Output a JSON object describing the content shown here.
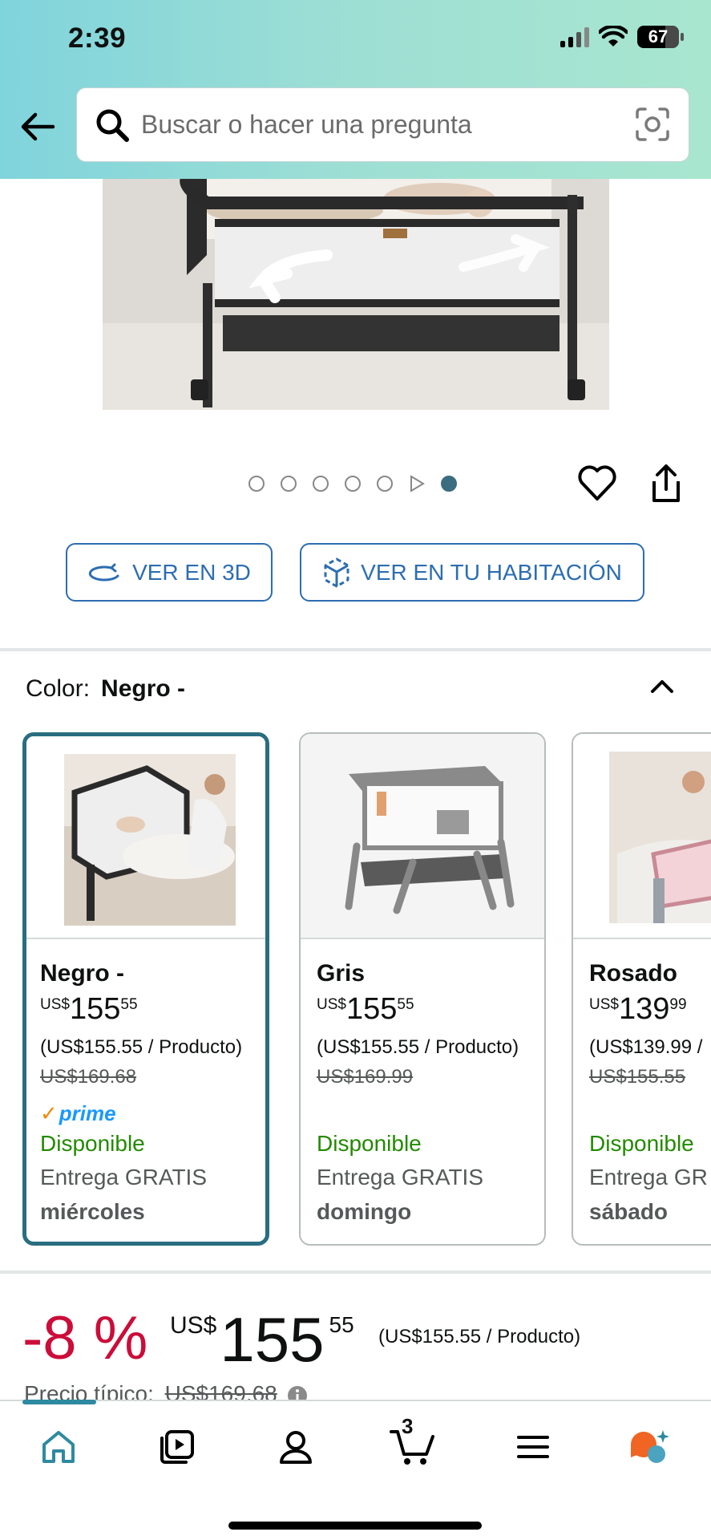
{
  "status_bar": {
    "time": "2:39",
    "battery": "67"
  },
  "search": {
    "placeholder": "Buscar o hacer una pregunta"
  },
  "gallery": {
    "dot_count": 7,
    "active_index": 6
  },
  "actions": {
    "view_3d": "VER EN 3D",
    "view_room": "VER EN TU HABITACIÓN"
  },
  "color_section": {
    "label": "Color:",
    "selected": "Negro -"
  },
  "variants": [
    {
      "name": "Negro -",
      "currency": "US$",
      "whole": "155",
      "fraction": "55",
      "unit_price": "(US$155.55 / Producto)",
      "list_price": "US$169.68",
      "prime": "prime",
      "availability": "Disponible",
      "delivery": "Entrega GRATIS",
      "delivery_day": "miércoles"
    },
    {
      "name": "Gris",
      "currency": "US$",
      "whole": "155",
      "fraction": "55",
      "unit_price": "(US$155.55 / Producto)",
      "list_price": "US$169.99",
      "availability": "Disponible",
      "delivery": "Entrega GRATIS",
      "delivery_day": "domingo"
    },
    {
      "name": "Rosado",
      "currency": "US$",
      "whole": "139",
      "fraction": "99",
      "unit_price": "(US$139.99 /",
      "list_price": "US$155.55",
      "availability": "Disponible",
      "delivery": "Entrega GR",
      "delivery_day": "sábado"
    }
  ],
  "price_block": {
    "discount": "-8 %",
    "currency": "US$",
    "whole": "155",
    "fraction": "55",
    "unit_price": "(US$155.55 / Producto)",
    "typical_label": "Precio típico:",
    "typical_price": "US$169.68"
  },
  "tabbar": {
    "cart_count": "3"
  },
  "colors": {
    "accent": "#296d80",
    "discount": "#cc0c39",
    "link": "#2d6db1",
    "available": "#238a00"
  }
}
